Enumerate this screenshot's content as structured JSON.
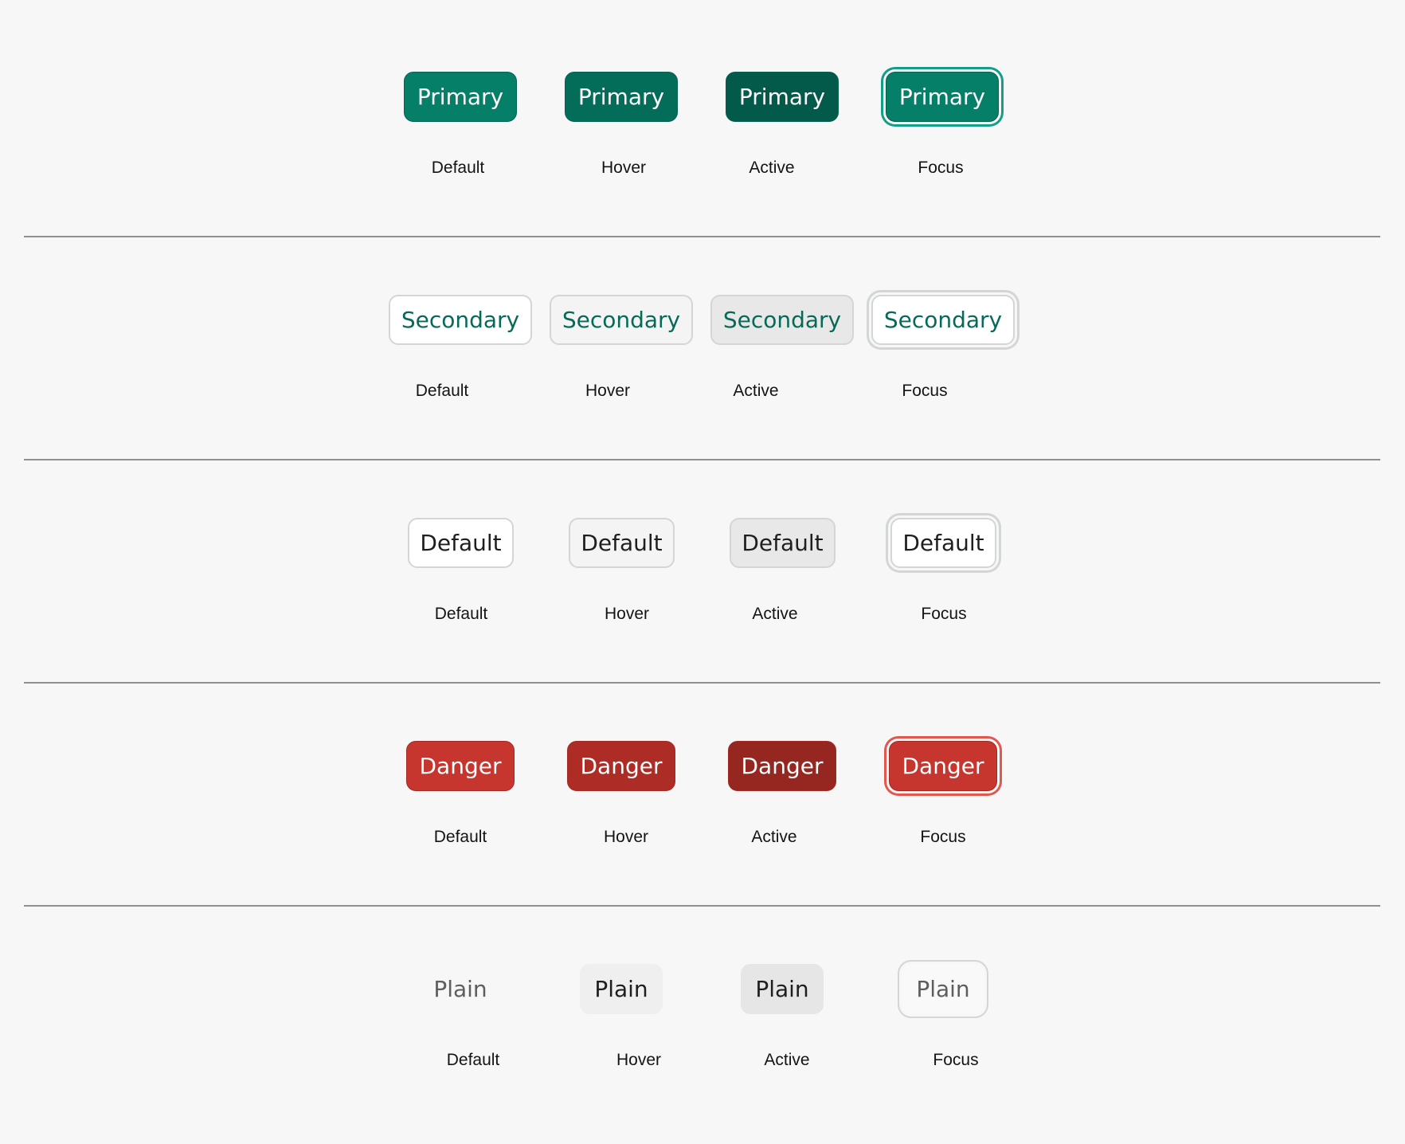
{
  "rows": [
    {
      "variant": "primary",
      "button_label": "Primary",
      "states": [
        "Default",
        "Hover",
        "Active",
        "Focus"
      ]
    },
    {
      "variant": "secondary",
      "button_label": "Secondary",
      "states": [
        "Default",
        "Hover",
        "Active",
        "Focus"
      ]
    },
    {
      "variant": "default",
      "button_label": "Default",
      "states": [
        "Default",
        "Hover",
        "Active",
        "Focus"
      ]
    },
    {
      "variant": "danger",
      "button_label": "Danger",
      "states": [
        "Default",
        "Hover",
        "Active",
        "Focus"
      ]
    },
    {
      "variant": "plain",
      "button_label": "Plain",
      "states": [
        "Default",
        "Hover",
        "Active",
        "Focus"
      ]
    }
  ],
  "colors": {
    "page_background": "#f6f7f6",
    "primary": "#067f69",
    "primary_hover": "#046d5a",
    "primary_active": "#035a4a",
    "primary_focus_ring": "#139e87",
    "secondary_text": "#076a58",
    "danger": "#c7362e",
    "danger_hover": "#ad2c26",
    "danger_active": "#962620",
    "danger_focus_ring": "#e2574e",
    "neutral_border": "#d3d6d5",
    "divider": "#8d918f"
  }
}
